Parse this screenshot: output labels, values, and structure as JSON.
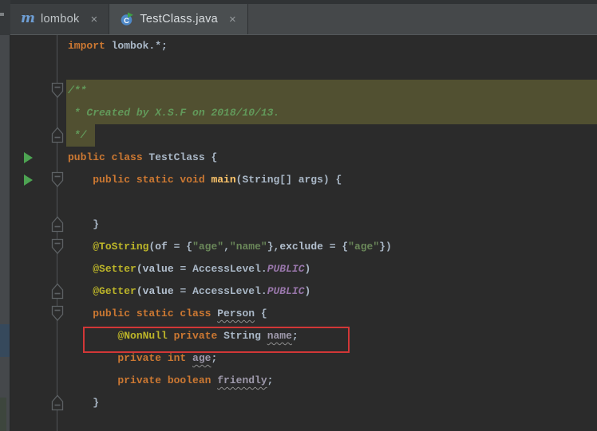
{
  "tabs": [
    {
      "label": "lombok",
      "icon": "maven-icon",
      "close_label": "×",
      "active": false
    },
    {
      "label": "TestClass.java",
      "icon": "java-class-icon",
      "close_label": "×",
      "active": true
    }
  ],
  "colors": {
    "editor_bg": "#2b2b2b",
    "tabbar_bg": "#3d4042",
    "active_tab_bg": "#4a4e50",
    "selection_highlight": "#515031",
    "error_box": "#d23737",
    "keyword": "#cc7832",
    "annotation": "#bcb529",
    "string": "#6a8759",
    "comment": "#62995a",
    "identifier": "#a9b7c6",
    "method": "#ffc66b",
    "constant": "#9876aa",
    "run_arrow": "#4da352",
    "fold_marker": "#5d6164"
  },
  "editor": {
    "lines": [
      {
        "tokens": [
          [
            "kw",
            "import"
          ],
          [
            "pl",
            " lombok.*;"
          ]
        ]
      },
      {
        "tokens": []
      },
      {
        "tokens": [
          [
            "cmt",
            "/**"
          ]
        ],
        "gutter": "fold-start",
        "sel": "full"
      },
      {
        "tokens": [
          [
            "cmt",
            " * Created by X.S.F on 2018/10/13."
          ]
        ],
        "sel": "full"
      },
      {
        "tokens": [
          [
            "cmt",
            " */"
          ]
        ],
        "gutter": "fold-end",
        "sel": "tail"
      },
      {
        "tokens": [
          [
            "kw",
            "public class "
          ],
          [
            "id",
            "TestClass"
          ],
          [
            "pl",
            " {"
          ]
        ],
        "run": true
      },
      {
        "tokens": [
          [
            "pl",
            "    "
          ],
          [
            "kw",
            "public static void "
          ],
          [
            "fn",
            "main"
          ],
          [
            "pl",
            "("
          ],
          [
            "id",
            "String[] args"
          ],
          [
            "pl",
            ") {"
          ]
        ],
        "run": true,
        "gutter": "fold-start"
      },
      {
        "tokens": []
      },
      {
        "tokens": [
          [
            "pl",
            "    }"
          ]
        ],
        "gutter": "fold-end"
      },
      {
        "tokens": [
          [
            "pl",
            "    "
          ],
          [
            "ann",
            "@ToString"
          ],
          [
            "pl",
            "("
          ],
          [
            "at",
            "of"
          ],
          [
            "pl",
            " = {"
          ],
          [
            "str",
            "\"age\""
          ],
          [
            "pl",
            ","
          ],
          [
            "str",
            "\"name\""
          ],
          [
            "pl",
            "},"
          ],
          [
            "at",
            "exclude"
          ],
          [
            "pl",
            " = {"
          ],
          [
            "str",
            "\"age\""
          ],
          [
            "pl",
            "})"
          ]
        ],
        "gutter": "fold-start"
      },
      {
        "tokens": [
          [
            "pl",
            "    "
          ],
          [
            "ann",
            "@Setter"
          ],
          [
            "pl",
            "("
          ],
          [
            "at",
            "value"
          ],
          [
            "pl",
            " = "
          ],
          [
            "id",
            "AccessLevel"
          ],
          [
            "pl",
            "."
          ],
          [
            "co",
            "PUBLIC"
          ],
          [
            "pl",
            ")"
          ]
        ]
      },
      {
        "tokens": [
          [
            "pl",
            "    "
          ],
          [
            "ann",
            "@Getter"
          ],
          [
            "pl",
            "("
          ],
          [
            "at",
            "value"
          ],
          [
            "pl",
            " = "
          ],
          [
            "id",
            "AccessLevel"
          ],
          [
            "pl",
            "."
          ],
          [
            "co",
            "PUBLIC"
          ],
          [
            "pl",
            ")"
          ]
        ],
        "gutter": "fold-end"
      },
      {
        "tokens": [
          [
            "pl",
            "    "
          ],
          [
            "kw",
            "public static class "
          ],
          [
            "ty",
            "Person"
          ],
          [
            "pl",
            " {"
          ]
        ],
        "gutter": "fold-start"
      },
      {
        "tokens": [
          [
            "pl",
            "        "
          ],
          [
            "ann",
            "@NonNull"
          ],
          [
            "pl",
            " "
          ],
          [
            "kw",
            "private "
          ],
          [
            "id",
            "String"
          ],
          [
            "pl",
            " "
          ],
          [
            "fd",
            "name"
          ],
          [
            "pl",
            ";"
          ]
        ],
        "redbox": true
      },
      {
        "tokens": [
          [
            "pl",
            "        "
          ],
          [
            "kw",
            "private int "
          ],
          [
            "fd",
            "age"
          ],
          [
            "pl",
            ";"
          ]
        ]
      },
      {
        "tokens": [
          [
            "pl",
            "        "
          ],
          [
            "kw",
            "private boolean "
          ],
          [
            "fd",
            "friendly"
          ],
          [
            "pl",
            ";"
          ]
        ]
      },
      {
        "tokens": [
          [
            "pl",
            "    }"
          ]
        ],
        "gutter": "fold-end"
      }
    ]
  }
}
